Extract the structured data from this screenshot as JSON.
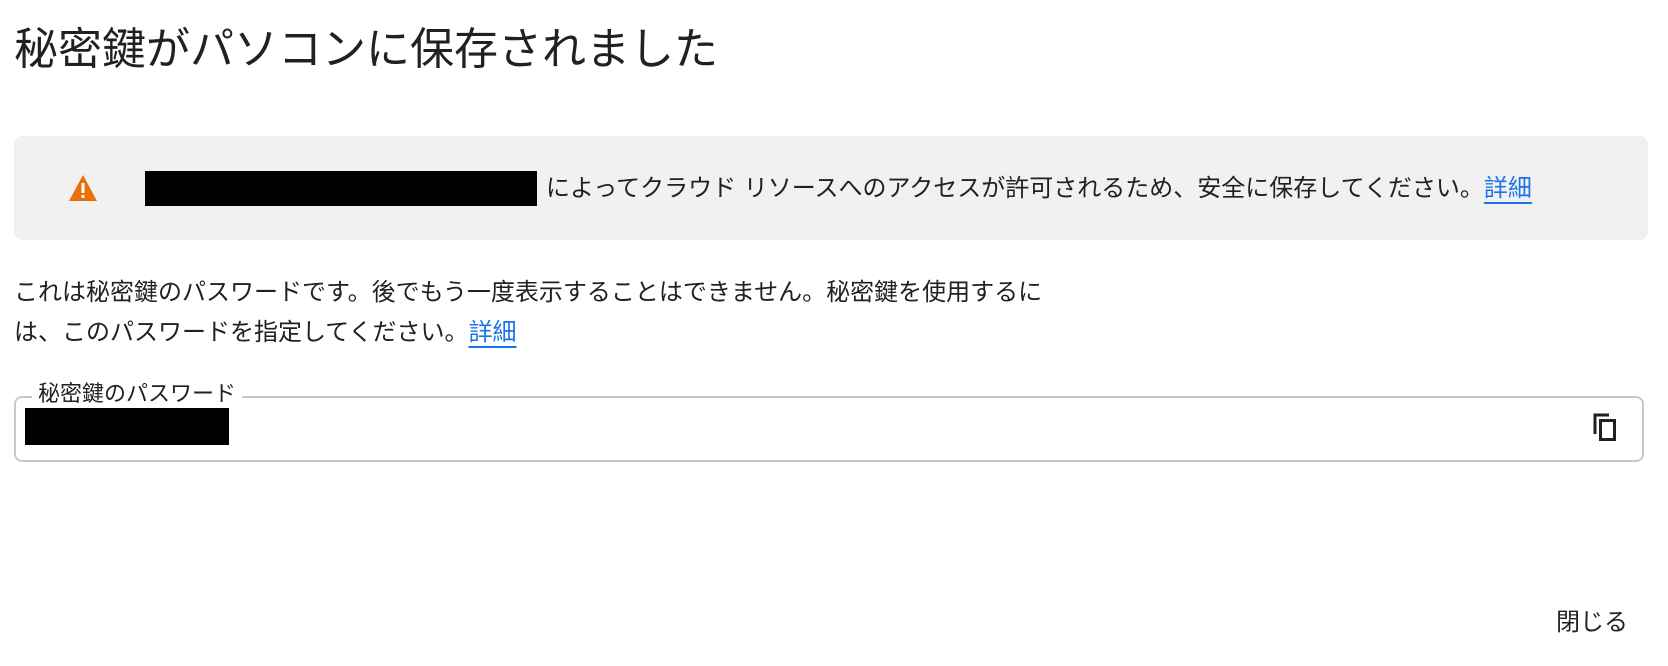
{
  "dialog": {
    "title": "秘密鍵がパソコンに保存されました"
  },
  "warning": {
    "icon": "warning-icon",
    "icon_color": "#e8710a",
    "message": "によってクラウド リソースへのアクセスが許可されるため、安全に保存してください。",
    "link_label": "詳細"
  },
  "description": {
    "text": "これは秘密鍵のパスワードです。後でもう一度表示することはできません。秘密鍵を使用するには、このパスワードを指定してください。",
    "link_label": "詳細"
  },
  "password_field": {
    "label": "秘密鍵のパスワード",
    "copy_icon": "copy-icon"
  },
  "footer": {
    "close_label": "閉じる"
  },
  "colors": {
    "link": "#1a73e8",
    "banner_background": "#f1f1f1",
    "field_border": "#c8c8c8"
  }
}
